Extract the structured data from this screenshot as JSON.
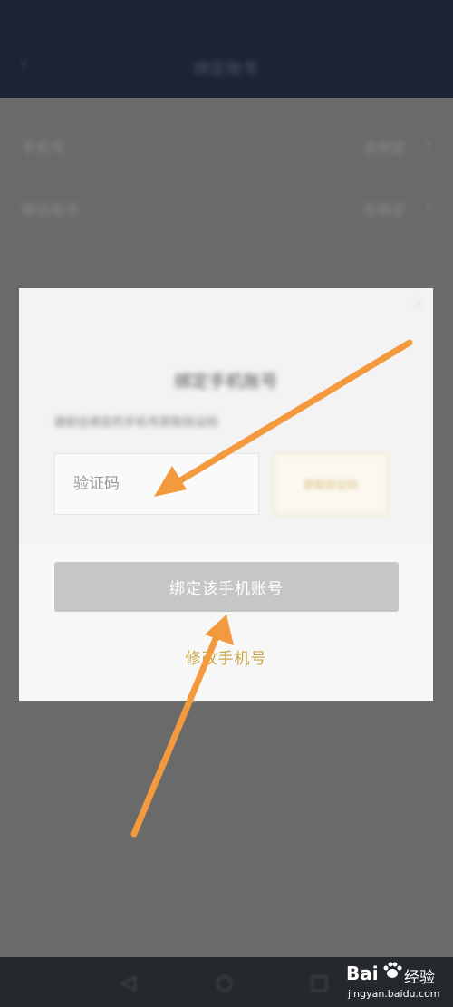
{
  "nav": {
    "back_icon": "chevron-left-icon",
    "title": "绑定账号"
  },
  "background_rows": [
    {
      "label": "手机号",
      "value": "去绑定"
    },
    {
      "label": "微信账号",
      "value": "去绑定"
    }
  ],
  "dialog": {
    "title": "绑定手机账号",
    "description": "请前往绑定的手机号获取验证码",
    "close_icon": "close-icon",
    "code_input": {
      "value": "",
      "placeholder": "验证码"
    },
    "get_code_label": "获取验证码",
    "bind_button": "绑定该手机账号",
    "modify_link": "修改手机号"
  },
  "system_nav": {
    "back_icon": "back-triangle-icon",
    "home_icon": "home-circle-icon",
    "recent_icon": "recent-square-icon"
  },
  "watermark": {
    "logo": "Bai",
    "brand": "经验",
    "url": "jingyan.baidu.com"
  },
  "colors": {
    "nav_bg": "#1b2436",
    "dim_bg": "#6a6a6a",
    "accent_gold": "#c9a84a",
    "arrow_orange": "#f39a3f",
    "button_disabled": "#c6c6c6"
  }
}
